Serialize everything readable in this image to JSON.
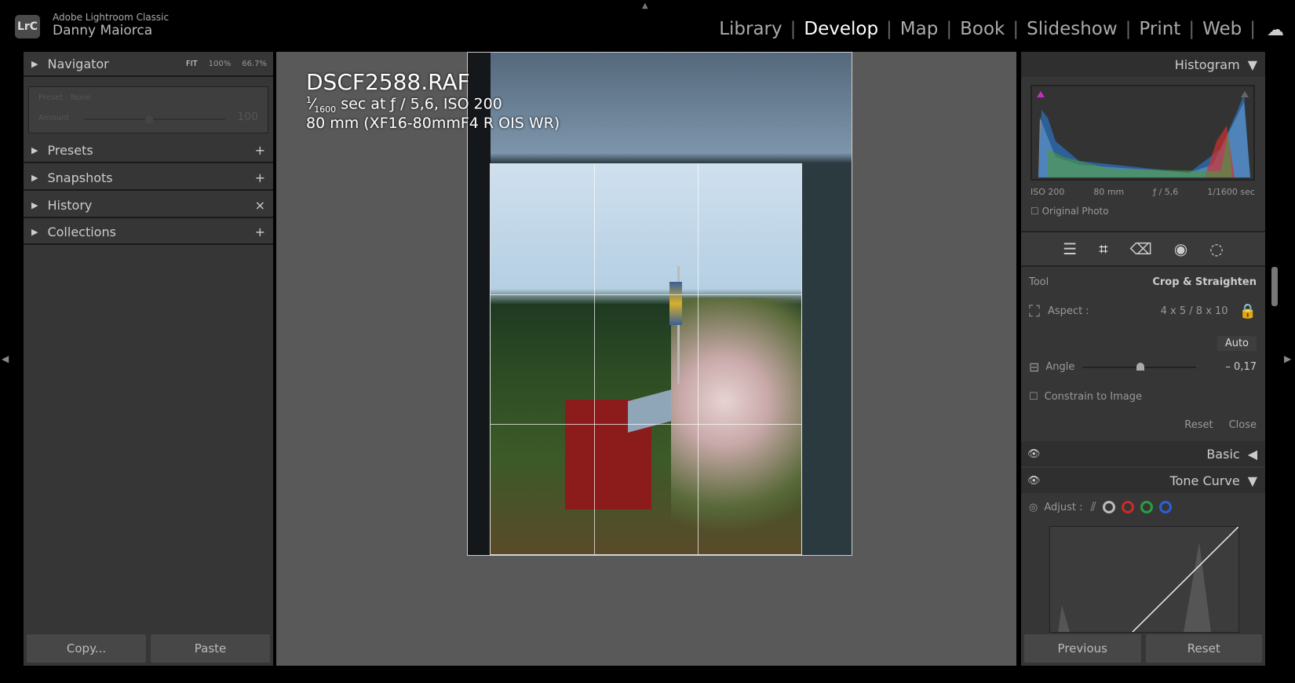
{
  "app": {
    "product": "Adobe Lightroom Classic",
    "user": "Danny Maiorca",
    "logo": "LrC"
  },
  "modules": [
    "Library",
    "Develop",
    "Map",
    "Book",
    "Slideshow",
    "Print",
    "Web"
  ],
  "active_module": "Develop",
  "left_panel": {
    "navigator": {
      "label": "Navigator",
      "zoom_options": [
        "FIT",
        "100%",
        "66.7%"
      ]
    },
    "preset_box": {
      "preset": "Preset : None",
      "amount_label": "Amount",
      "amount_value": "100"
    },
    "sections": [
      {
        "label": "Presets",
        "action": "+"
      },
      {
        "label": "Snapshots",
        "action": "+"
      },
      {
        "label": "History",
        "action": "×"
      },
      {
        "label": "Collections",
        "action": "+"
      }
    ],
    "copy": "Copy...",
    "paste": "Paste"
  },
  "photo_info": {
    "filename": "DSCF2588.RAF",
    "exposure_num": "1",
    "exposure_den": "1600",
    "exposure_rest": " sec at ƒ / 5,6, ISO 200",
    "lens": "80 mm (XF16-80mmF4 R OIS WR)"
  },
  "right_panel": {
    "histogram": {
      "label": "Histogram",
      "iso": "ISO 200",
      "focal": "80 mm",
      "aperture": "ƒ / 5,6",
      "shutter": "1/1600 sec",
      "original_photo": "Original Photo"
    },
    "tools": [
      "sliders-icon",
      "crop-icon",
      "eraser-icon",
      "redeye-icon",
      "mask-icon"
    ],
    "crop": {
      "tool_label": "Tool",
      "tool_name": "Crop & Straighten",
      "aspect_label": "Aspect :",
      "aspect_value": "4 x 5  /  8 x 10",
      "auto": "Auto",
      "angle_label": "Angle",
      "angle_value": "– 0,17",
      "angle_fraction": 0.47,
      "constrain": "Constrain to Image",
      "reset": "Reset",
      "close": "Close"
    },
    "basic": "Basic",
    "tone_curve": "Tone Curve",
    "adjust_label": "Adjust :",
    "channel_colors": [
      "#bbbbbb",
      "#d02828",
      "#28a040",
      "#2a60d8"
    ],
    "previous": "Previous",
    "reset": "Reset"
  },
  "colors": {
    "histogram_clip_shadow": "#c030c0"
  }
}
